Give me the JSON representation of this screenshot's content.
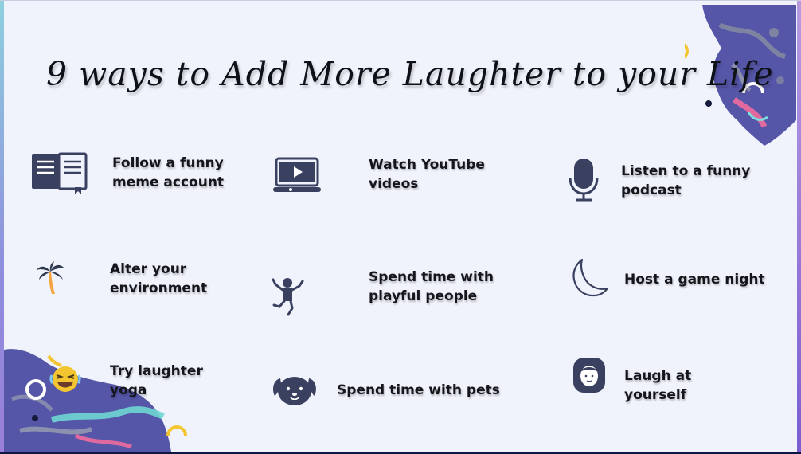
{
  "title": "9 ways to Add More Laughter to your  Life",
  "colors": {
    "background": "#f1f3fc",
    "icon": "#3a4160",
    "title_text": "#0e1118",
    "accent_yellow": "#f2c531",
    "blob_purple": "#5656a8",
    "blob_pink": "#e06aa0",
    "blob_teal": "#6fd6d2"
  },
  "items": [
    {
      "line1": "Follow a funny",
      "line2": "meme account",
      "icon": "book-icon"
    },
    {
      "line1": "Watch YouTube",
      "line2": "videos",
      "icon": "video-laptop-icon"
    },
    {
      "line1": "Listen to a funny",
      "line2": "podcast",
      "icon": "microphone-icon"
    },
    {
      "line1": "Alter your",
      "line2": "environment",
      "icon": "palm-tree-icon"
    },
    {
      "line1": "Spend time with",
      "line2": "playful people",
      "icon": "jumping-person-icon"
    },
    {
      "line1": "Host a game night",
      "line2": "",
      "icon": "moon-icon"
    },
    {
      "line1": "Try laughter",
      "line2": "yoga",
      "icon": "laughing-emoji-icon"
    },
    {
      "line1": "Spend time with pets",
      "line2": "",
      "icon": "dog-face-icon"
    },
    {
      "line1": "Laugh at",
      "line2": "yourself",
      "icon": "woman-avatar-icon"
    }
  ]
}
